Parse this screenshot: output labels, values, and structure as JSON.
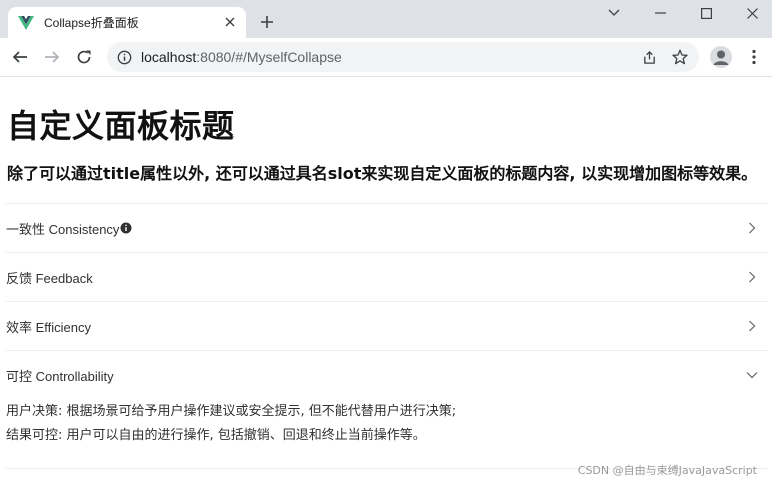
{
  "browser": {
    "tab_title": "Collapse折叠面板",
    "url_host": "localhost",
    "url_rest": ":8080/#/MyselfCollapse"
  },
  "page": {
    "heading": "自定义面板标题",
    "subheading": "除了可以通过title属性以外, 还可以通过具名slot来实现自定义面板的标题内容, 以实现增加图标等效果。",
    "items": [
      {
        "title": "一致性 Consistency",
        "expanded": false,
        "has_info_icon": true
      },
      {
        "title": "反馈 Feedback",
        "expanded": false
      },
      {
        "title": "效率 Efficiency",
        "expanded": false
      },
      {
        "title": "可控 Controllability",
        "expanded": true,
        "content": [
          "用户决策: 根据场景可给予用户操作建议或安全提示, 但不能代替用户进行决策;",
          "结果可控: 用户可以自由的进行操作, 包括撤销、回退和终止当前操作等。"
        ]
      }
    ],
    "watermark": "CSDN @自由与束缚JavaJavaScript"
  },
  "colors": {
    "vue_green": "#42b883",
    "vue_dark": "#35495e",
    "border": "#ebeef5",
    "text": "#303133"
  }
}
